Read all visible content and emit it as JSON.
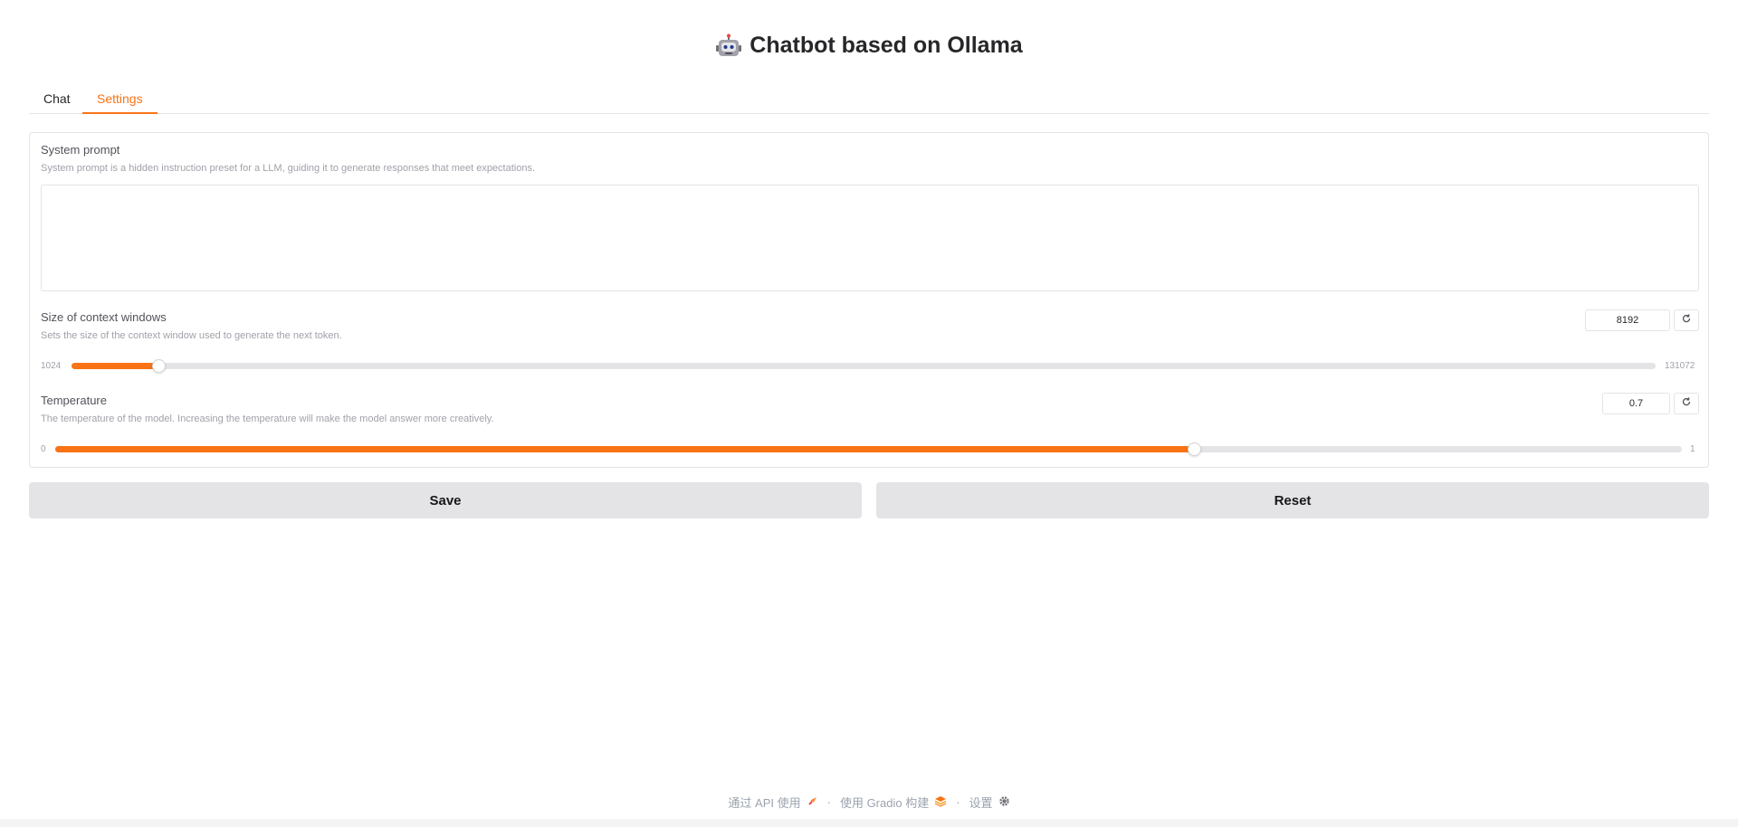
{
  "title": {
    "emoji": "🤖",
    "text": "Chatbot based on Ollama"
  },
  "tabs": [
    {
      "label": "Chat",
      "active": false
    },
    {
      "label": "Settings",
      "active": true
    }
  ],
  "settings": {
    "system_prompt": {
      "label": "System prompt",
      "info": "System prompt is a hidden instruction preset for a LLM, guiding it to generate responses that meet expectations.",
      "value": ""
    },
    "context_window": {
      "label": "Size of context windows",
      "info": "Sets the size of the context window used to generate the next token.",
      "value": "8192",
      "min": "1024",
      "max": "131072",
      "fraction": 0.0547
    },
    "temperature": {
      "label": "Temperature",
      "info": "The temperature of the model. Increasing the temperature will make the model answer more creatively.",
      "value": "0.7",
      "min": "0",
      "max": "1",
      "fraction": 0.7
    }
  },
  "buttons": {
    "save": "Save",
    "reset": "Reset"
  },
  "footer": {
    "api": "通过 API 使用",
    "built": "使用 Gradio 构建",
    "settings": "设置",
    "separator": "·"
  },
  "colors": {
    "accent": "#f97316",
    "button_bg": "#e4e4e7"
  },
  "icons": {
    "title": "robot-icon",
    "reset": "refresh-icon",
    "api": "rocket-icon",
    "gradio": "gradio-logo-icon",
    "settings": "gear-icon"
  }
}
